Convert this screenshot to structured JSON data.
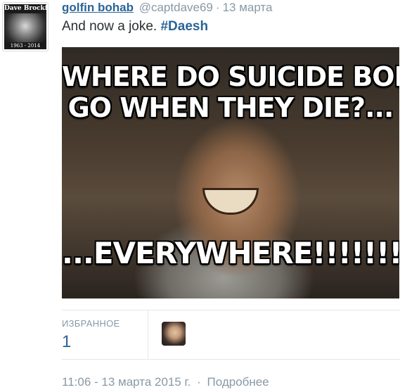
{
  "avatar": {
    "top_text": "Dave Brockie",
    "bottom_text": "1963 - 2014"
  },
  "tweet": {
    "user_name": "golfin bohab",
    "handle": "@captdave69",
    "separator": "·",
    "date": "13 марта",
    "text": "And now a joke.",
    "hashtag": "#Daesh"
  },
  "media": {
    "caption_line1": "WHERE DO SUICIDE BOMBERS",
    "caption_line2": "GO WHEN THEY DIE?...",
    "caption_line3": "...EVERYWHERE!!!!!!!"
  },
  "stats": {
    "favorites_label": "ИЗБРАННОЕ",
    "favorites_count": "1"
  },
  "footer": {
    "timestamp": "11:06 - 13 марта 2015 г.",
    "separator": "·",
    "details_label": "Подробнее"
  },
  "colors": {
    "link": "#2a6496",
    "muted": "#8899a6",
    "text": "#292f33",
    "divider": "#e1e8ed"
  },
  "icons": {
    "favoriter_avatar": "user-avatar-icon"
  }
}
